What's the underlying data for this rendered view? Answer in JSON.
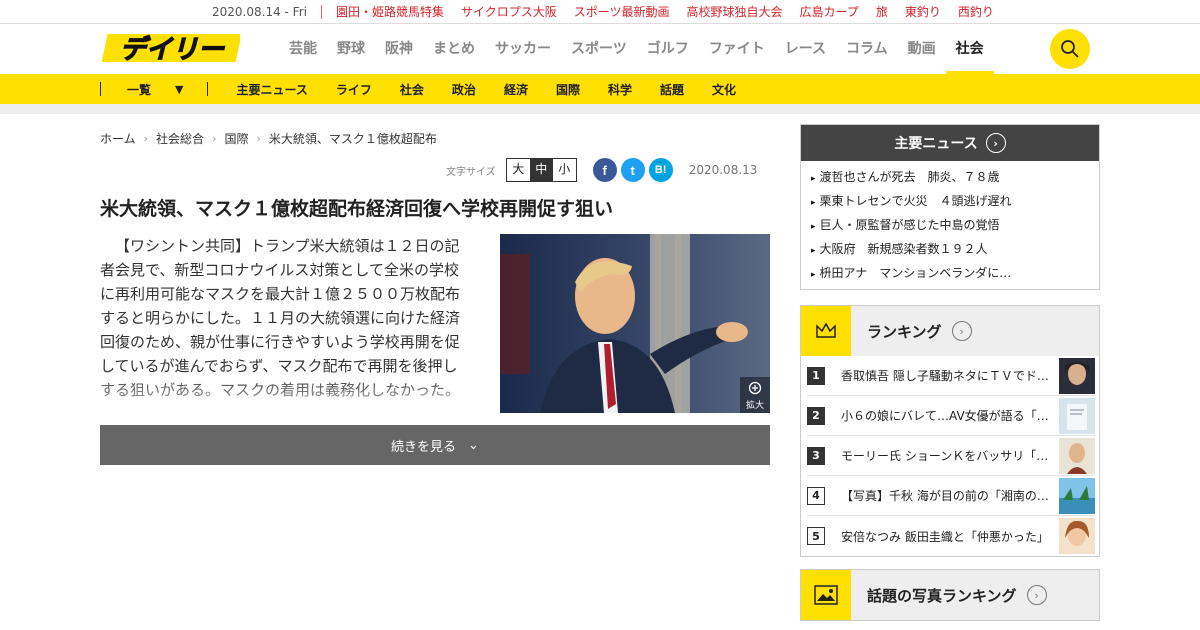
{
  "topbar": {
    "date": "2020.08.14 - Fri",
    "links": [
      "園田・姫路競馬特集",
      "サイクロプス大阪",
      "スポーツ最新動画",
      "高校野球独自大会",
      "広島カープ",
      "旅",
      "東釣り",
      "西釣り"
    ]
  },
  "header": {
    "logo_text": "デイリー",
    "nav": [
      "芸能",
      "野球",
      "阪神",
      "まとめ",
      "サッカー",
      "スポーツ",
      "ゴルフ",
      "ファイト",
      "レース",
      "コラム",
      "動画",
      "社会"
    ],
    "active_nav": "社会"
  },
  "subnav": {
    "list_label": "一覧",
    "items": [
      "主要ニュース",
      "ライフ",
      "社会",
      "政治",
      "経済",
      "国際",
      "科学",
      "話題",
      "文化"
    ]
  },
  "article": {
    "breadcrumb": [
      "ホーム",
      "社会総合",
      "国際",
      "米大統領、マスク１億枚超配布"
    ],
    "font_size_label": "文字サイズ",
    "font_sizes": [
      "大",
      "中",
      "小"
    ],
    "active_size": "中",
    "share": {
      "facebook": "f",
      "twitter": "t",
      "hatena": "B!"
    },
    "date": "2020.08.13",
    "title": "米大統領、マスク１億枚超配布経済回復へ学校再開促す狙い",
    "body": "【ワシントン共同】トランプ米大統領は１２日の記者会見で、新型コロナウイルス対策として全米の学校に再利用可能なマスクを最大計１億２５００万枚配布すると明らかにした。１１月の大統領選に向けた経済回復のため、親が仕事に行きやすいよう学校再開を促しているが進んでおらず、マスク配布で再開を後押しする狙いがある。マスクの着用は義務化しなかった。",
    "zoom_label": "拡大",
    "more_label": "続きを見る"
  },
  "sidebar": {
    "news_title": "主要ニュース",
    "news": [
      "渡哲也さんが死去　肺炎、７８歳",
      "栗東トレセンで火災　４頭逃げ遅れ",
      "巨人・原監督が感じた中島の覚悟",
      "大阪府　新規感染者数１９２人",
      "枡田アナ　マンションベランダに…"
    ],
    "ranking_title": "ランキング",
    "ranking": [
      {
        "rank": "1",
        "text": "香取慎吾 隠し子騒動ネタにＴＶでド…"
      },
      {
        "rank": "2",
        "text": "小６の娘にバレて…AV女優が語る「…"
      },
      {
        "rank": "3",
        "text": "モーリー氏 ショーンＫをバッサリ「…"
      },
      {
        "rank": "4",
        "text": "【写真】千秋 海が目の前の「湘南の…"
      },
      {
        "rank": "5",
        "text": "安倍なつみ 飯田圭織と「仲悪かった」"
      }
    ],
    "photo_ranking_title": "話題の写真ランキング"
  },
  "colors": {
    "accent": "#ffe000",
    "topbar_link": "#d4232a",
    "facebook": "#3b5998",
    "twitter": "#1da1f2",
    "hatena": "#00a4de"
  }
}
